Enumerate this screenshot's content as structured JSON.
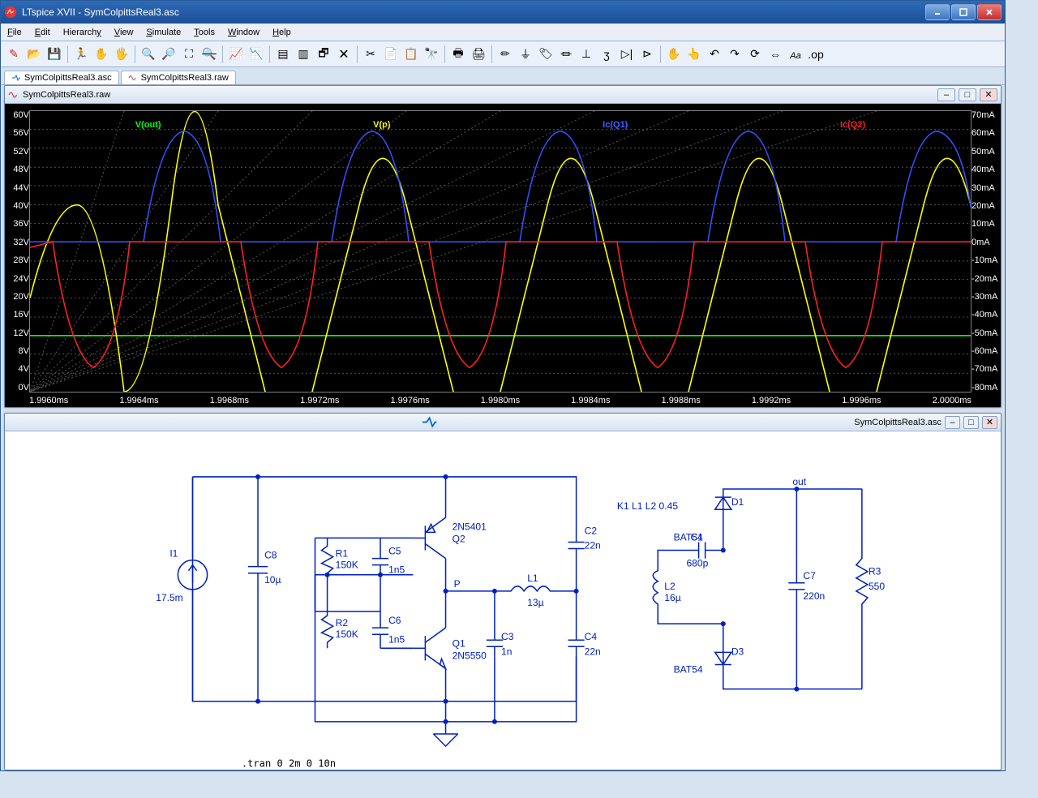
{
  "app": {
    "title": "LTspice XVII - SymColpittsReal3.asc"
  },
  "menus": [
    "File",
    "Edit",
    "Hierarchy",
    "View",
    "Simulate",
    "Tools",
    "Window",
    "Help"
  ],
  "toolbar_icons": [
    "new-schematic",
    "open",
    "save",
    "|",
    "run",
    "halt",
    "pan",
    "|",
    "zoom-in",
    "zoom-out",
    "zoom-fit",
    "zoom-full",
    "|",
    "autoscale",
    "add-trace",
    "|",
    "tile-horz",
    "tile-vert",
    "cascade",
    "close-all",
    "|",
    "cut",
    "copy",
    "paste",
    "find",
    "|",
    "print",
    "print-setup",
    "|",
    "wire",
    "ground",
    "label",
    "resistor",
    "capacitor",
    "inductor",
    "diode",
    "component",
    "|",
    "move",
    "drag",
    "undo",
    "redo",
    "rotate",
    "mirror",
    "text",
    "op"
  ],
  "doc_tabs": [
    {
      "label": "SymColpittsReal3.asc",
      "kind": "schematic"
    },
    {
      "label": "SymColpittsReal3.raw",
      "kind": "waveform"
    }
  ],
  "waveform": {
    "title": "SymColpittsReal3.raw",
    "traces": [
      {
        "name": "V(out)",
        "color": "#00ff00"
      },
      {
        "name": "V(p)",
        "color": "#ffff00"
      },
      {
        "name": "Ic(Q1)",
        "color": "#2040ff"
      },
      {
        "name": "Ic(Q2)",
        "color": "#ff2020"
      }
    ],
    "y_left": [
      "60V",
      "56V",
      "52V",
      "48V",
      "44V",
      "40V",
      "36V",
      "32V",
      "28V",
      "24V",
      "20V",
      "16V",
      "12V",
      "8V",
      "4V",
      "0V"
    ],
    "y_right": [
      "70mA",
      "60mA",
      "50mA",
      "40mA",
      "30mA",
      "20mA",
      "10mA",
      "0mA",
      "-10mA",
      "-20mA",
      "-30mA",
      "-40mA",
      "-50mA",
      "-60mA",
      "-70mA",
      "-80mA"
    ],
    "x_ticks": [
      "1.9960ms",
      "1.9964ms",
      "1.9968ms",
      "1.9972ms",
      "1.9976ms",
      "1.9980ms",
      "1.9984ms",
      "1.9988ms",
      "1.9992ms",
      "1.9996ms",
      "2.0000ms"
    ]
  },
  "schematic": {
    "title": "SymColpittsReal3.asc",
    "components": {
      "I1": {
        "name": "I1",
        "value": "17.5m"
      },
      "C8": {
        "name": "C8",
        "value": "10µ"
      },
      "R1": {
        "name": "R1",
        "value": "150K"
      },
      "R2": {
        "name": "R2",
        "value": "150K"
      },
      "C5": {
        "name": "C5",
        "value": "1n5"
      },
      "C6": {
        "name": "C6",
        "value": "1n5"
      },
      "Q1": {
        "name": "Q1",
        "value": "2N5550"
      },
      "Q2": {
        "name": "Q2",
        "value": "2N5401"
      },
      "C3": {
        "name": "C3",
        "value": "1n"
      },
      "L1": {
        "name": "L1",
        "value": "13µ"
      },
      "C2": {
        "name": "C2",
        "value": "22n"
      },
      "C4": {
        "name": "C4",
        "value": "22n"
      },
      "L2": {
        "name": "L2",
        "value": "16µ"
      },
      "C1": {
        "name": "C1",
        "value": "680p"
      },
      "D1": {
        "name": "D1",
        "value": "BAT54"
      },
      "D3": {
        "name": "D3",
        "value": "BAT54"
      },
      "C7": {
        "name": "C7",
        "value": "220n"
      },
      "R3": {
        "name": "R3",
        "value": "550"
      }
    },
    "net_p": "P",
    "net_out": "out",
    "k_directive": "K1 L1 L2 0.45",
    "spice_directive": ".tran 0 2m 0 10n"
  }
}
